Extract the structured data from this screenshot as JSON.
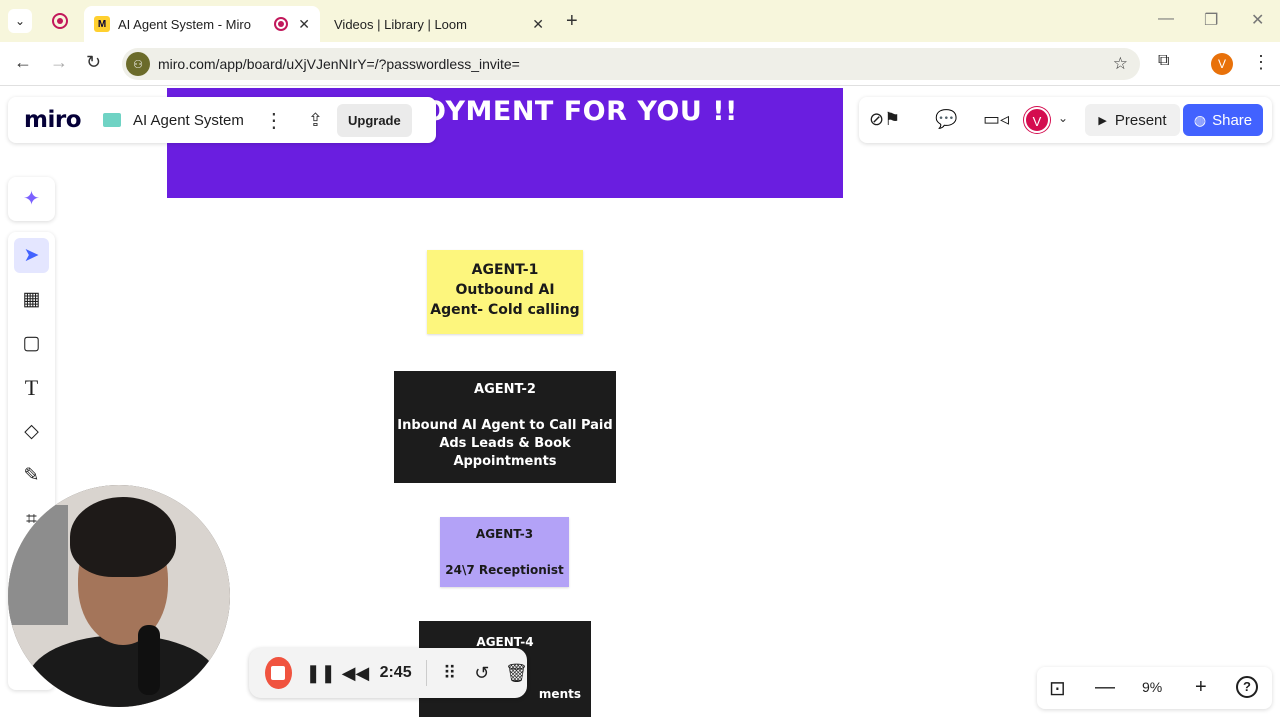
{
  "browser": {
    "tabs": [
      {
        "title": "AI Agent System - Miro",
        "active": true
      },
      {
        "title": "Videos | Library | Loom",
        "active": false
      }
    ],
    "url": "miro.com/app/board/uXjVJenNIrY=/?passwordless_invite=",
    "profile_initial": "V"
  },
  "miro": {
    "logo": "miro",
    "board_name": "AI Agent System",
    "upgrade_label": "Upgrade",
    "user_initial": "V",
    "present_label": "Present",
    "share_label": "Share",
    "zoom_level": "9%"
  },
  "canvas": {
    "banner_text": "EPLOYMENT FOR YOU !!",
    "banner_color": "#6a1ee0",
    "stickies": [
      {
        "title": "AGENT-1",
        "lines": [
          "Outbound AI",
          "Agent- Cold calling"
        ],
        "color": "#fdf67d"
      },
      {
        "title": "AGENT-2",
        "lines": [
          "Inbound AI Agent to Call Paid",
          "Ads Leads & Book",
          "Appointments"
        ],
        "color": "#1c1c1c"
      },
      {
        "title": "AGENT-3",
        "lines": [
          "24\\7 Receptionist"
        ],
        "color": "#b3a2f7"
      },
      {
        "title": "AGENT-4",
        "lines": [
          "ments"
        ],
        "color": "#1c1c1c"
      }
    ]
  },
  "loom": {
    "timer": "2:45"
  },
  "colors": {
    "share_blue": "#4262ff",
    "loom_stop": "#f0533f",
    "tab_bar": "#f7f6dc"
  }
}
